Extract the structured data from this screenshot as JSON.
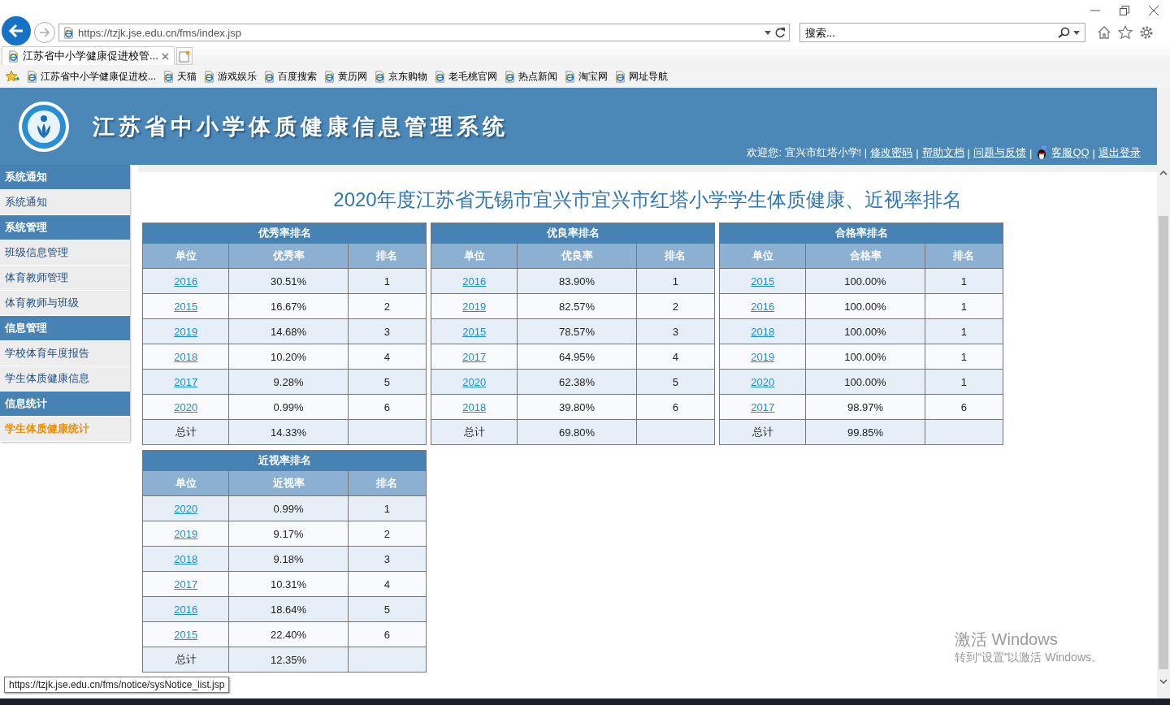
{
  "browser": {
    "address": "https://tzjk.jse.edu.cn/fms/index.jsp",
    "search": {
      "placeholder": "搜索..."
    },
    "tabs": [
      {
        "label": "江苏省中小学健康促进校管...",
        "selected": true
      }
    ],
    "favorites": [
      "江苏省中小学健康促进校...",
      "天猫",
      "游戏娱乐",
      "百度搜索",
      "黄历网",
      "京东购物",
      "老毛桃官网",
      "热点新闻",
      "淘宝网",
      "网址导航"
    ]
  },
  "header": {
    "title": "江苏省中小学体质健康信息管理系统",
    "welcome": "欢迎您: 宜兴市红塔小学! |",
    "links": [
      {
        "label": "修改密码",
        "separator": "|"
      },
      {
        "label": "帮助文档",
        "separator": "|"
      },
      {
        "label": "问题与反馈",
        "separator": "|"
      },
      {
        "label": "客服QQ",
        "separator": "|",
        "kind": "qq"
      },
      {
        "label": "退出登录"
      }
    ]
  },
  "sidebar": [
    {
      "title": "系统通知",
      "items": [
        {
          "label": "系统通知",
          "selected": false
        }
      ]
    },
    {
      "title": "系统管理",
      "items": [
        {
          "label": "班级信息管理",
          "selected": false
        },
        {
          "label": "体育教师管理",
          "selected": false
        },
        {
          "label": "体育教师与班级",
          "selected": false
        }
      ]
    },
    {
      "title": "信息管理",
      "items": [
        {
          "label": "学校体育年度报告",
          "selected": false
        },
        {
          "label": "学生体质健康信息",
          "selected": false
        }
      ]
    },
    {
      "title": "信息统计",
      "items": [
        {
          "label": "学生体质健康统计",
          "selected": true
        }
      ]
    }
  ],
  "page_title": "2020年度江苏省无锡市宜兴市宜兴市红塔小学学生体质健康、近视率排名",
  "tables": [
    {
      "title": "优秀率排名",
      "columns": [
        "单位",
        "优秀率",
        "排名"
      ],
      "rows": [
        {
          "unit": "2016",
          "rate": "30.51%",
          "rank": "1"
        },
        {
          "unit": "2015",
          "rate": "16.67%",
          "rank": "2"
        },
        {
          "unit": "2019",
          "rate": "14.68%",
          "rank": "3"
        },
        {
          "unit": "2018",
          "rate": "10.20%",
          "rank": "4"
        },
        {
          "unit": "2017",
          "rate": "9.28%",
          "rank": "5"
        },
        {
          "unit": "2020",
          "rate": "0.99%",
          "rank": "6"
        }
      ],
      "total": {
        "label": "总计",
        "rate": "14.33%"
      }
    },
    {
      "title": "优良率排名",
      "columns": [
        "单位",
        "优良率",
        "排名"
      ],
      "rows": [
        {
          "unit": "2016",
          "rate": "83.90%",
          "rank": "1"
        },
        {
          "unit": "2019",
          "rate": "82.57%",
          "rank": "2"
        },
        {
          "unit": "2015",
          "rate": "78.57%",
          "rank": "3"
        },
        {
          "unit": "2017",
          "rate": "64.95%",
          "rank": "4"
        },
        {
          "unit": "2020",
          "rate": "62.38%",
          "rank": "5"
        },
        {
          "unit": "2018",
          "rate": "39.80%",
          "rank": "6"
        }
      ],
      "total": {
        "label": "总计",
        "rate": "69.80%"
      }
    },
    {
      "title": "合格率排名",
      "columns": [
        "单位",
        "合格率",
        "排名"
      ],
      "rows": [
        {
          "unit": "2015",
          "rate": "100.00%",
          "rank": "1"
        },
        {
          "unit": "2016",
          "rate": "100.00%",
          "rank": "1"
        },
        {
          "unit": "2018",
          "rate": "100.00%",
          "rank": "1"
        },
        {
          "unit": "2019",
          "rate": "100.00%",
          "rank": "1"
        },
        {
          "unit": "2020",
          "rate": "100.00%",
          "rank": "1"
        },
        {
          "unit": "2017",
          "rate": "98.97%",
          "rank": "6"
        }
      ],
      "total": {
        "label": "总计",
        "rate": "99.85%"
      }
    },
    {
      "title": "近视率排名",
      "columns": [
        "单位",
        "近视率",
        "排名"
      ],
      "rows": [
        {
          "unit": "2020",
          "rate": "0.99%",
          "rank": "1"
        },
        {
          "unit": "2019",
          "rate": "9.17%",
          "rank": "2"
        },
        {
          "unit": "2018",
          "rate": "9.18%",
          "rank": "3"
        },
        {
          "unit": "2017",
          "rate": "10.31%",
          "rank": "4"
        },
        {
          "unit": "2016",
          "rate": "18.64%",
          "rank": "5"
        },
        {
          "unit": "2015",
          "rate": "22.40%",
          "rank": "6"
        }
      ],
      "total": {
        "label": "总计",
        "rate": "12.35%"
      }
    }
  ],
  "status_url": "https://tzjk.jse.edu.cn/fms/notice/sysNotice_list.jsp",
  "activation": {
    "title": "激活 Windows",
    "message": "转到“设置”以激活 Windows。"
  }
}
